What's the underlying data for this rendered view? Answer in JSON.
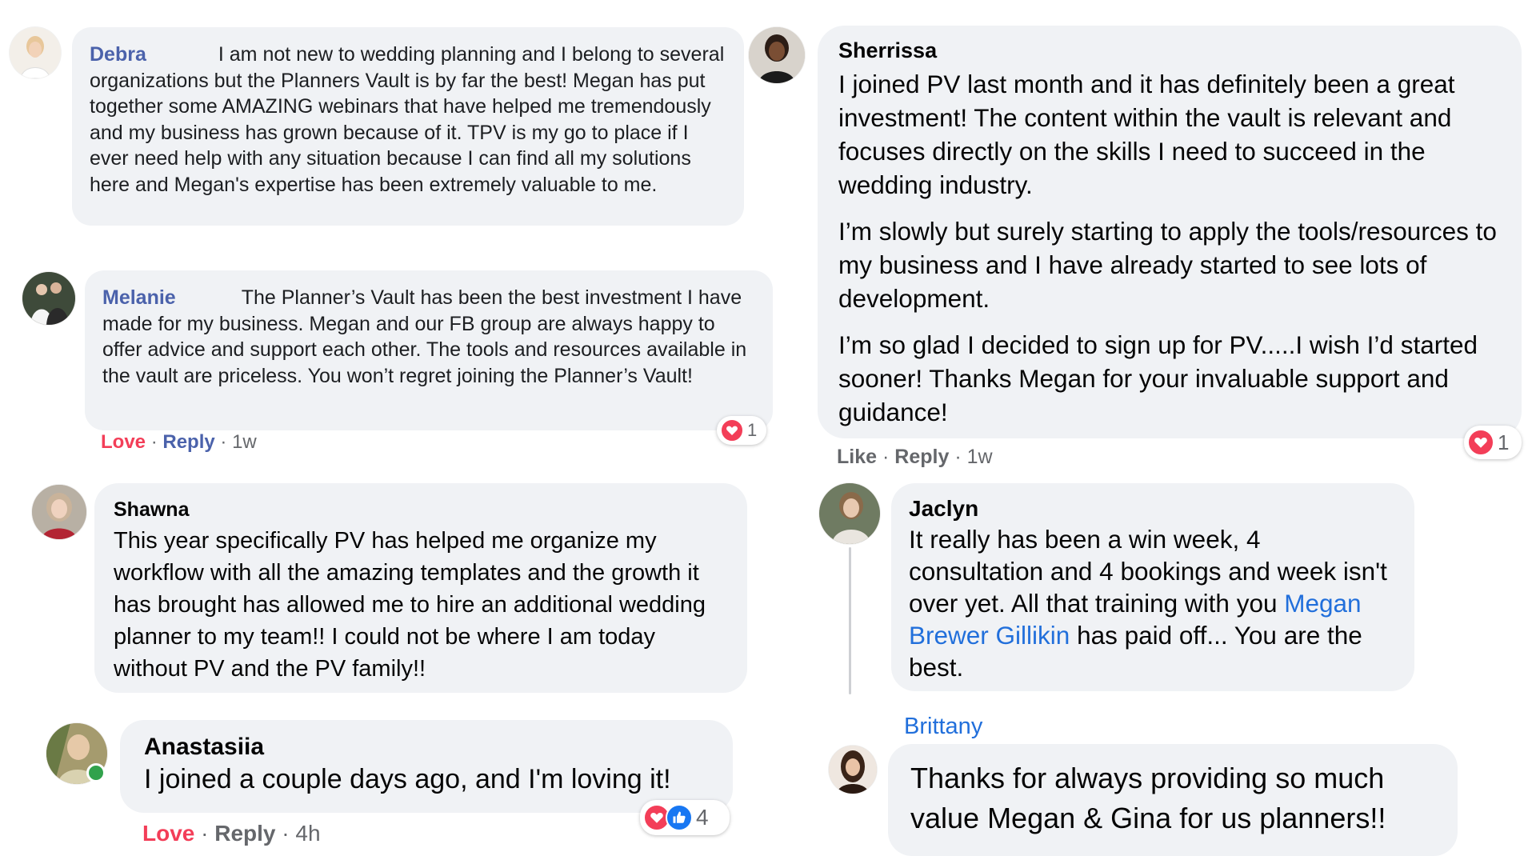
{
  "comments": {
    "debra": {
      "name": "Debra",
      "text": "I am not new to wedding planning and I belong to several organizations but the Planners Vault is by far the best! Megan has put together some AMAZING webinars that have helped me tremendously and my business has grown because of it. TPV is my go to place if I ever need help with any situation because I can find all my solutions here and Megan's expertise has been extremely valuable to me."
    },
    "melanie": {
      "name": "Melanie",
      "text": "The Planner’s Vault has been the best investment I have made for my business. Megan and our FB group are always happy to offer advice and support each other. The tools and resources available in the vault are priceless. You won’t regret joining the Planner’s Vault!",
      "reaction_label": "Love",
      "reply_label": "Reply",
      "time": "1w",
      "reaction_count": "1"
    },
    "shawna": {
      "name": "Shawna",
      "text": "This year specifically PV has helped me organize my workflow with all the amazing templates and the growth it has brought has allowed me to hire an additional wedding planner to my team!! I could not be where I am today without PV and the PV family!!"
    },
    "anastasiia": {
      "name": "Anastasiia",
      "text": "I joined a couple days ago, and I'm loving it!",
      "reaction_label": "Love",
      "reply_label": "Reply",
      "time": "4h",
      "reaction_count": "4"
    },
    "sherrissa": {
      "name": "Sherrissa",
      "paragraphs": [
        "I joined PV last month and it has definitely been a great investment! The content within the vault is relevant and focuses directly on the skills I need to succeed in the wedding industry.",
        "I’m slowly but surely starting to apply the tools/resources to my business and I have already started to see lots of development.",
        "I’m so glad I decided to sign up for PV.....I wish I’d started sooner! Thanks Megan for your invaluable support and guidance!"
      ],
      "reaction_label": "Like",
      "reply_label": "Reply",
      "time": "1w",
      "reaction_count": "1"
    },
    "jaclyn": {
      "name": "Jaclyn",
      "text_before": "It really has been a win week, 4 consultation and 4 bookings and week isn't over yet. All that training with you",
      "mention": "Megan Brewer Gillikin",
      "text_after": "has paid off... You are the best."
    },
    "brittany": {
      "name": "Brittany",
      "text": "Thanks for always providing so much value Megan & Gina for us planners!!"
    }
  },
  "separator_dot": "·",
  "colors": {
    "bubble": "#f0f2f5",
    "love": "#f33e58",
    "link_name": "#4b62ab",
    "mention": "#216fdb",
    "like": "#1877f2",
    "online": "#31a24c"
  },
  "icons": {
    "heart": "heart-reaction-icon",
    "like": "thumbs-up-reaction-icon"
  }
}
